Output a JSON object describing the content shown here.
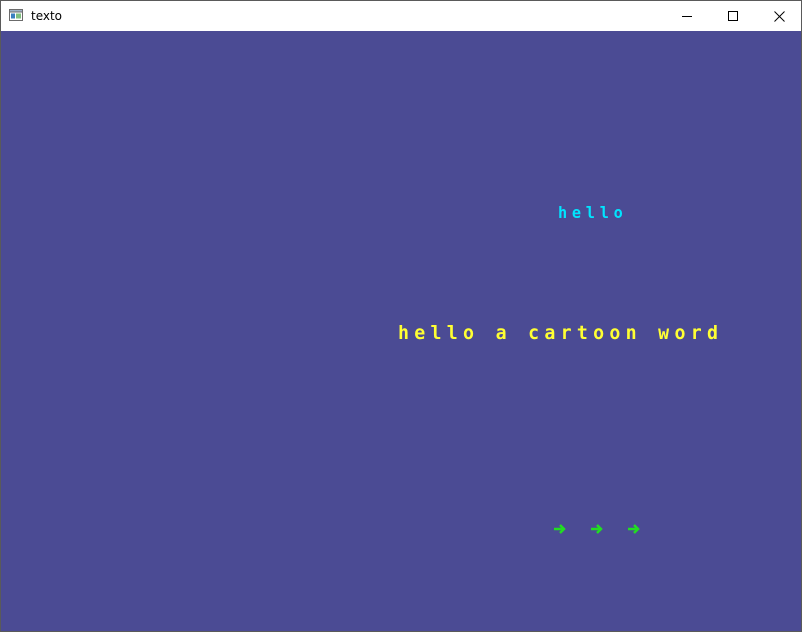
{
  "window": {
    "title": "texto",
    "icon": "app-window-icon",
    "controls": [
      "minimize-icon",
      "maximize-icon",
      "close-icon"
    ]
  },
  "canvas": {
    "background": "#4b4b94",
    "hello_text": "HELLO",
    "hello_color": "#00e5ff",
    "cartoon_text": "HELLO A CARTOON WORD",
    "cartoon_color": "#ffff33",
    "arrows": [
      "arrow-right-icon",
      "arrow-right-icon",
      "arrow-right-icon"
    ],
    "arrow_color": "#22dd22"
  }
}
